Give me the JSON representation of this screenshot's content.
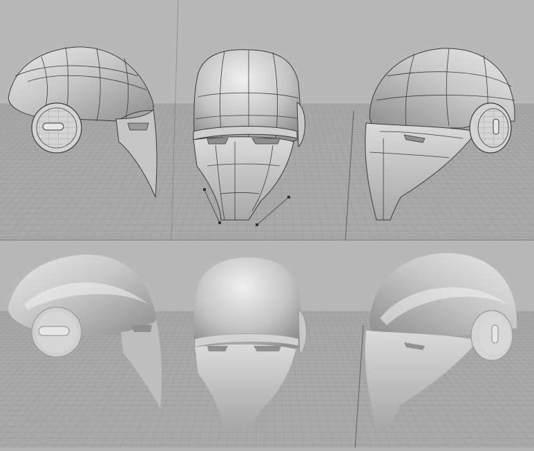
{
  "scene": {
    "background_color": "#b4b4b4",
    "floor_color": "#a9a9a9",
    "grid_color": "#9a9a9a",
    "divider_color": "#6e6e6e",
    "shell_color": "#bdbdbd",
    "shell_highlight": "#e6e6e6",
    "wire_color": "#3a3a3a"
  },
  "viewports": [
    {
      "id": "wire-left",
      "mode": "wireframe",
      "view": "side-left"
    },
    {
      "id": "wire-front",
      "mode": "wireframe",
      "view": "front"
    },
    {
      "id": "wire-right",
      "mode": "wireframe",
      "view": "side-right"
    },
    {
      "id": "shaded-left",
      "mode": "shaded",
      "view": "side-left"
    },
    {
      "id": "shaded-front",
      "mode": "shaded",
      "view": "front"
    },
    {
      "id": "shaded-right",
      "mode": "shaded",
      "view": "side-right"
    }
  ]
}
